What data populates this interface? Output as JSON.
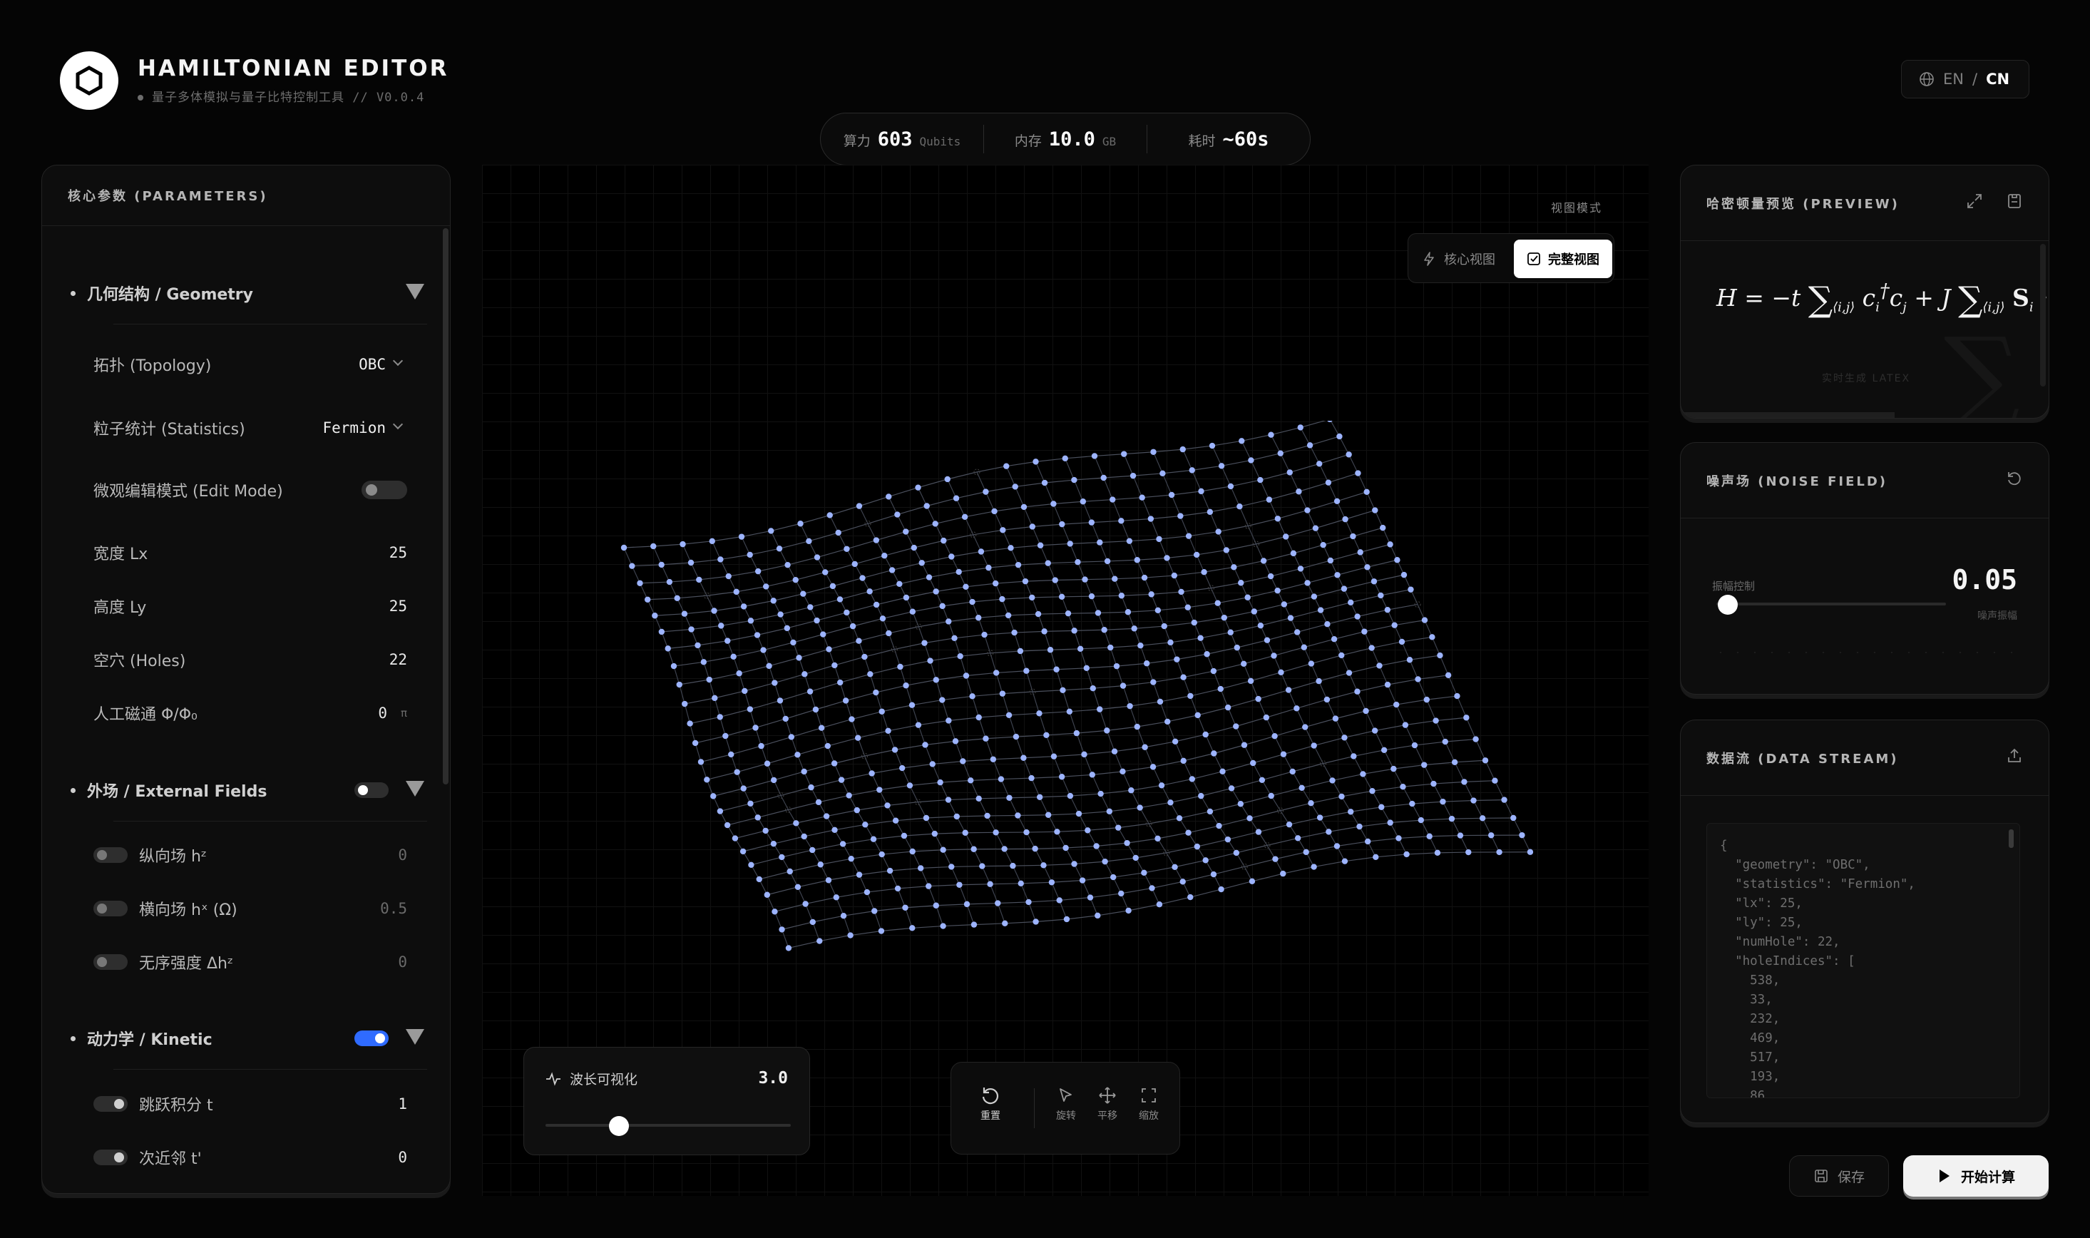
{
  "app": {
    "title": "HAMILTONIAN EDITOR",
    "subtitle": "量子多体模拟与量子比特控制工具 // V0.0.4",
    "logo_icon": "hexagon-icon"
  },
  "language": {
    "en": "EN",
    "sep": "/",
    "cn": "CN",
    "active": "CN"
  },
  "stats": [
    {
      "label": "算力",
      "value": "603",
      "unit": "Qubits"
    },
    {
      "label": "内存",
      "value": "10.0",
      "unit": "GB"
    },
    {
      "label": "耗时",
      "value": "~60s",
      "unit": ""
    }
  ],
  "params": {
    "title": "核心参数 (PARAMETERS)",
    "geometry": {
      "title": "几何结构 / Geometry",
      "topology_label": "拓扑 (Topology)",
      "topology_value": "OBC",
      "statistics_label": "粒子统计 (Statistics)",
      "statistics_value": "Fermion",
      "edit_mode_label": "微观编辑模式 (Edit Mode)",
      "edit_mode_on": false,
      "lx_label": "宽度 Lx",
      "lx": "25",
      "ly_label": "高度 Ly",
      "ly": "25",
      "holes_label": "空穴 (Holes)",
      "holes": "22",
      "flux_label": "人工磁通 Φ/Φ₀",
      "flux": "0",
      "flux_unit": "π"
    },
    "external": {
      "title": "外场 / External Fields",
      "enabled": false,
      "hz_label": "纵向场 hᶻ",
      "hz": "0",
      "hx_label": "横向场 hˣ (Ω)",
      "hx": "0.5",
      "disorder_label": "无序强度 Δhᶻ",
      "disorder": "0"
    },
    "kinetic": {
      "title": "动力学 / Kinetic",
      "enabled": true,
      "hop_label": "跳跃积分 t",
      "hop": "1",
      "nnn_label": "次近邻 t'",
      "nnn": "0"
    }
  },
  "viewport": {
    "mode_label": "视图模式",
    "core_view": "核心视图",
    "full_view": "完整视图",
    "active_view": "full_view"
  },
  "wavelength": {
    "label": "波长可视化",
    "value": "3.0",
    "slider_fraction": 0.3
  },
  "tools": {
    "reset": "重置",
    "rotate": "旋转",
    "pan": "平移",
    "zoom": "缩放"
  },
  "preview": {
    "title": "哈密顿量预览 (PREVIEW)",
    "render_note": "实时生成 LATEX"
  },
  "noise": {
    "title": "噪声场 (NOISE FIELD)",
    "amp_label": "振幅控制",
    "value": "0.05",
    "sub_label": "噪声振幅",
    "slider_fraction": 0.05
  },
  "stream": {
    "title": "数据流 (DATA STREAM)",
    "json_lines": [
      "{",
      "  \"geometry\": \"OBC\",",
      "  \"statistics\": \"Fermion\",",
      "  \"lx\": 25,",
      "  \"ly\": 25,",
      "  \"numHole\": 22,",
      "  \"holeIndices\": [",
      "    538,",
      "    33,",
      "    232,",
      "    469,",
      "    517,",
      "    193,",
      "    86,"
    ]
  },
  "actions": {
    "save": "保存",
    "run": "开始计算"
  },
  "colors": {
    "accent": "#2f6bff",
    "node": "#9db4ff",
    "background": "#050505"
  }
}
